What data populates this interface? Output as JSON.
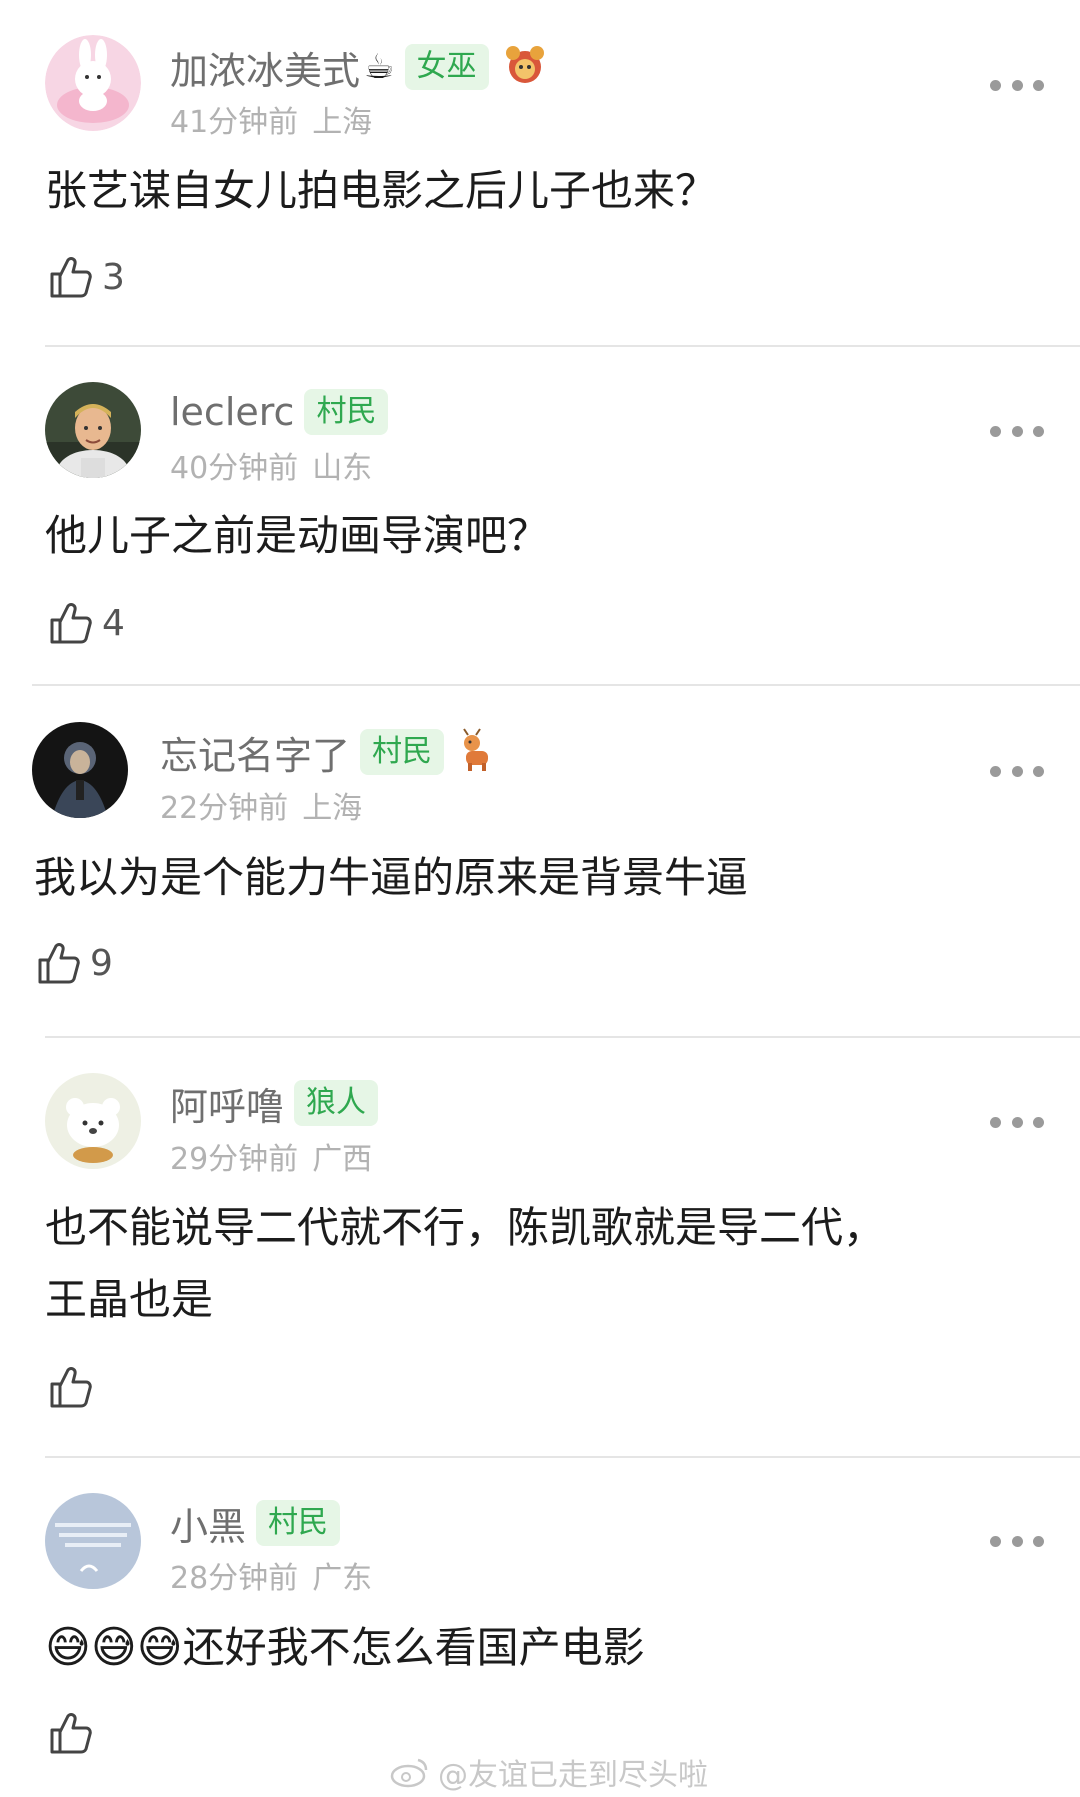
{
  "comments": [
    {
      "username": "加浓冰美式",
      "name_emoji": "☕",
      "badge": "女巫",
      "decoration": "red-bear-sticker",
      "time": "41分钟前",
      "location": "上海",
      "text": "张艺谋自女儿拍电影之后儿子也来？",
      "likes": "3"
    },
    {
      "username": "leclerc",
      "badge": "村民",
      "time": "40分钟前",
      "location": "山东",
      "text": "他儿子之前是动画导演吧？",
      "likes": "4"
    },
    {
      "username": "忘记名字了",
      "badge": "村民",
      "decoration": "deer-sticker",
      "time": "22分钟前",
      "location": "上海",
      "text": "我以为是个能力牛逼的原来是背景牛逼",
      "likes": "9"
    },
    {
      "username": "阿呼噜",
      "badge": "狼人",
      "time": "29分钟前",
      "location": "广西",
      "text_line1": "也不能说导二代就不行，陈凯歌就是导二代，",
      "text_line2": "王晶也是",
      "likes": ""
    },
    {
      "username": "小黑",
      "badge": "村民",
      "time": "28分钟前",
      "location": "广东",
      "emoji": "😅",
      "text": "还好我不怎么看国产电影",
      "likes": ""
    }
  ],
  "colors": {
    "badge_bg": "#e6f6e6",
    "badge_text": "#2fa84f",
    "username": "#6f6f6f",
    "meta": "#b2b2b2"
  },
  "watermark": "@友谊已走到尽头啦"
}
